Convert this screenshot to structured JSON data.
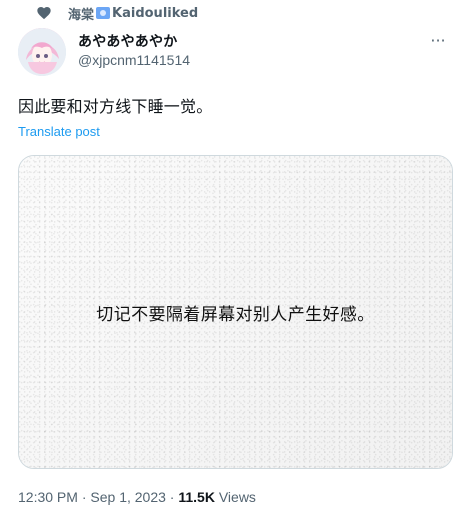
{
  "liked_by": {
    "name": "海棠",
    "account": "Kaidou",
    "action": " liked"
  },
  "tweet": {
    "display_name": "あやあやあやか",
    "handle": "@xjpcnm1141514",
    "more": "···",
    "text": "因此要和对方线下睡一觉。",
    "translate": "Translate post",
    "image_text": "切记不要隔着屏幕对别人产生好感。",
    "time": "12:30 PM",
    "date": "Sep 1, 2023",
    "views_count": "11.5K",
    "views_label": "Views"
  },
  "icons": {
    "heart": "heart-icon",
    "verified": "verified-icon",
    "more": "more-icon"
  },
  "colors": {
    "link": "#1d9bf0",
    "muted": "#536471",
    "text": "#0f1419",
    "border": "#cfd9de"
  }
}
